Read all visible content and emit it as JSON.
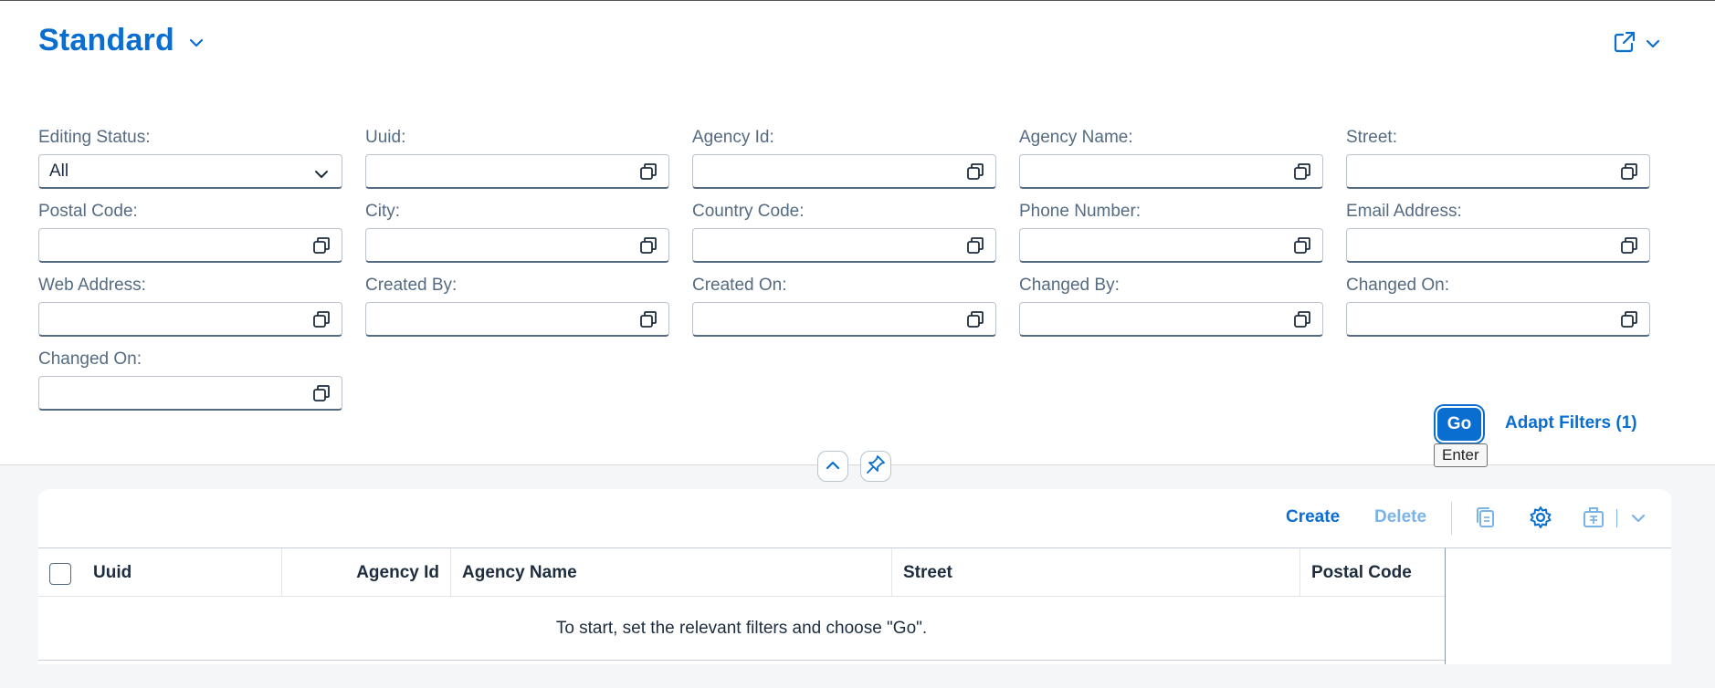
{
  "variant": {
    "title": "Standard"
  },
  "filters": [
    {
      "label": "Editing Status:",
      "value": "All",
      "type": "select"
    },
    {
      "label": "Uuid:",
      "value": "",
      "type": "input"
    },
    {
      "label": "Agency Id:",
      "value": "",
      "type": "input"
    },
    {
      "label": "Agency Name:",
      "value": "",
      "type": "input"
    },
    {
      "label": "Street:",
      "value": "",
      "type": "input"
    },
    {
      "label": "Postal Code:",
      "value": "",
      "type": "input"
    },
    {
      "label": "City:",
      "value": "",
      "type": "input"
    },
    {
      "label": "Country Code:",
      "value": "",
      "type": "input"
    },
    {
      "label": "Phone Number:",
      "value": "",
      "type": "input"
    },
    {
      "label": "Email Address:",
      "value": "",
      "type": "input"
    },
    {
      "label": "Web Address:",
      "value": "",
      "type": "input"
    },
    {
      "label": "Created By:",
      "value": "",
      "type": "input"
    },
    {
      "label": "Created On:",
      "value": "",
      "type": "input"
    },
    {
      "label": "Changed By:",
      "value": "",
      "type": "input"
    },
    {
      "label": "Changed On:",
      "value": "",
      "type": "input"
    },
    {
      "label": "Changed On:",
      "value": "",
      "type": "input"
    }
  ],
  "actions": {
    "go_label": "Go",
    "go_tooltip": "Enter",
    "adapt_filters_label": "Adapt Filters (1)"
  },
  "toolbar": {
    "create_label": "Create",
    "delete_label": "Delete"
  },
  "table": {
    "columns": [
      "Uuid",
      "Agency Id",
      "Agency Name",
      "Street",
      "Postal Code"
    ],
    "no_data_text": "To start, set the relevant filters and choose \"Go\"."
  },
  "colors": {
    "brand": "#0a6ed1",
    "disabled": "#7ab3ea",
    "label": "#556b82"
  },
  "icons": [
    "chevron-down-icon",
    "share-icon",
    "value-help-icon",
    "collapse-icon",
    "pin-icon",
    "copy-icon",
    "settings-icon",
    "export-icon",
    "checkbox"
  ]
}
